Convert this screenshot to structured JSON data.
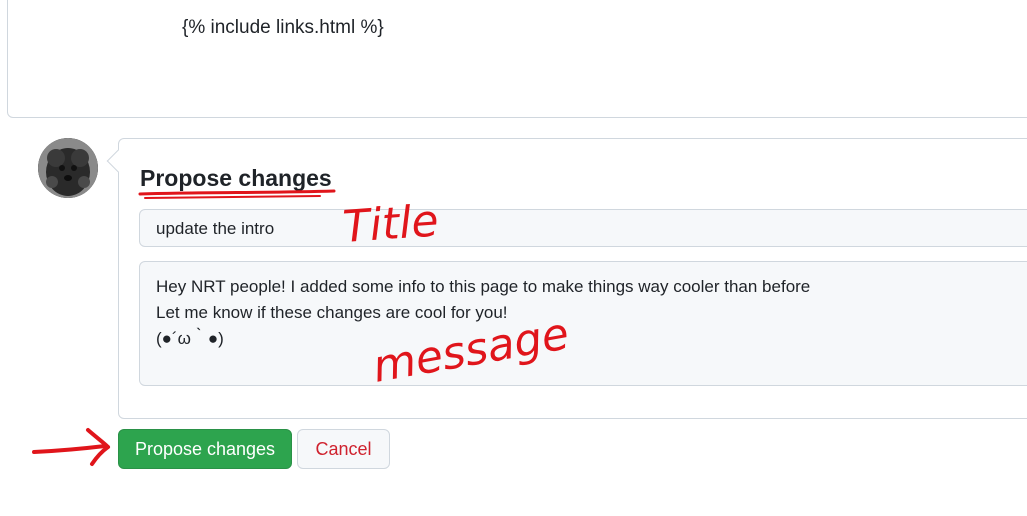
{
  "editor": {
    "line": "{% include links.html %}"
  },
  "form": {
    "heading": "Propose changes",
    "title_value": "update the intro",
    "message_lines": [
      "Hey NRT people! I added some info to this page to make things way cooler than before",
      "Let me know if these changes are cool for you!",
      "(●´ω｀●)"
    ]
  },
  "buttons": {
    "submit_label": "Propose changes",
    "cancel_label": "Cancel"
  },
  "annotations": {
    "title_note": "Title",
    "message_note": "message"
  },
  "colors": {
    "accent_green": "#2da44e",
    "cancel_red": "#cf222e",
    "annotation_red": "#e0151b"
  },
  "icons": {
    "avatar": "user-avatar-dog-photo",
    "pointer": "hand-drawn-arrow"
  }
}
